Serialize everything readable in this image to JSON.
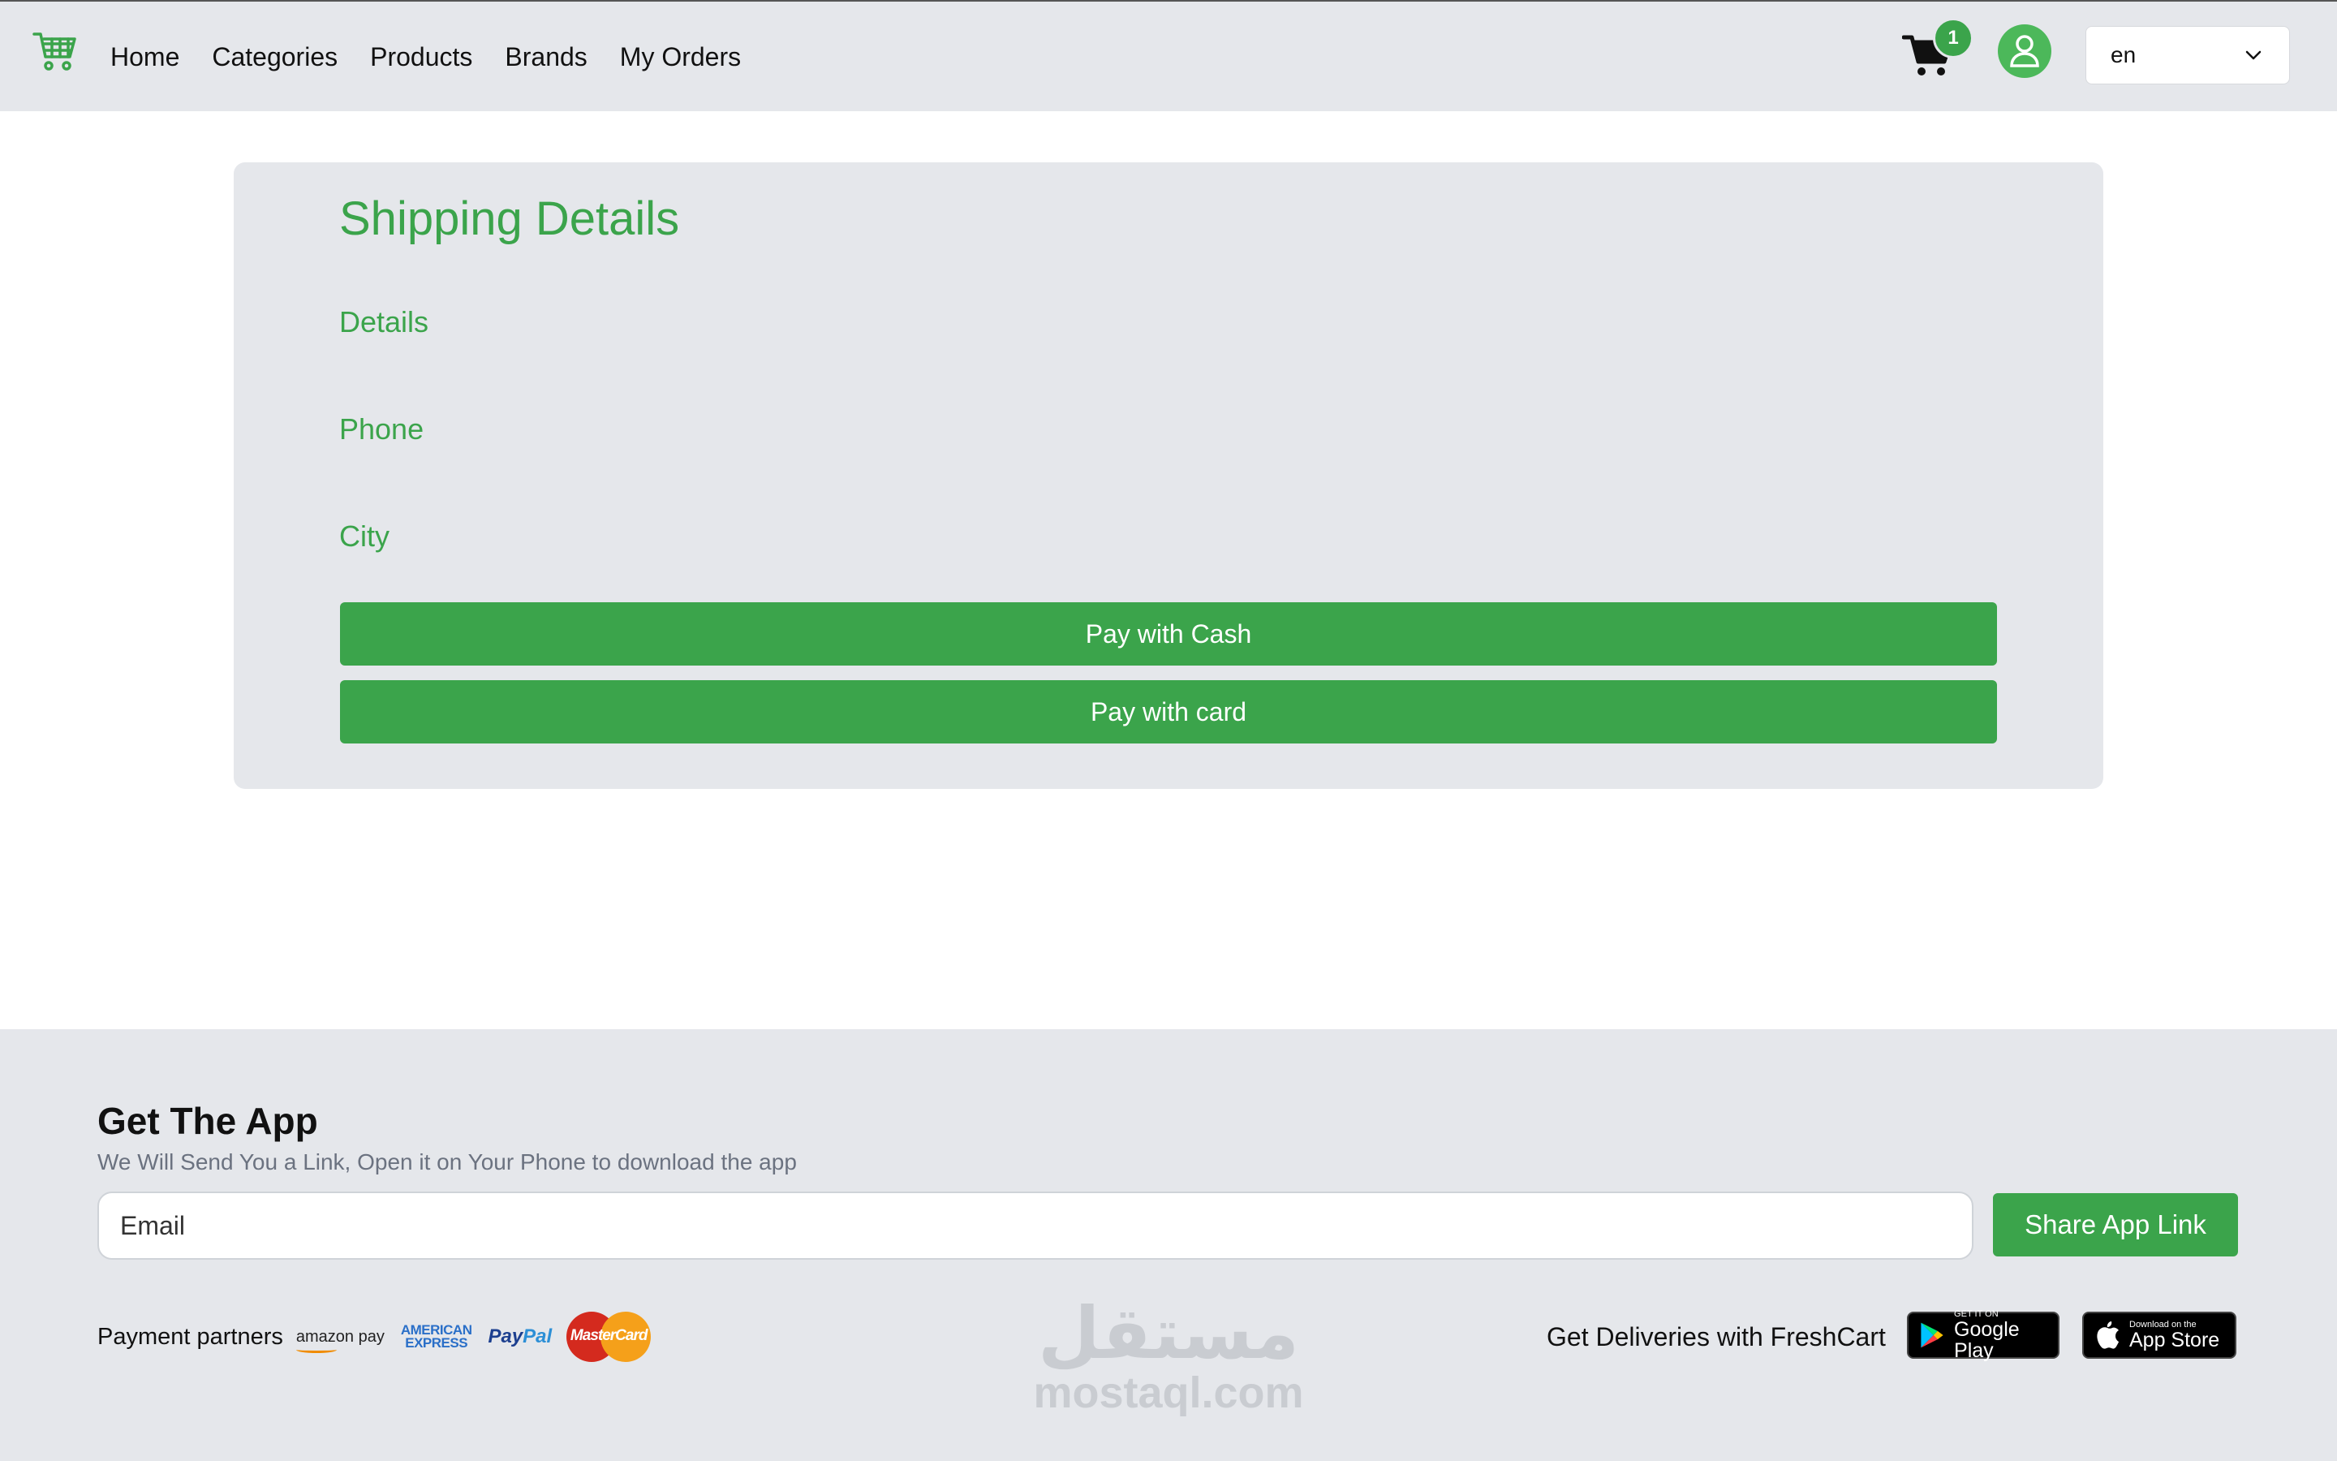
{
  "nav": {
    "links": [
      "Home",
      "Categories",
      "Products",
      "Brands",
      "My Orders"
    ],
    "cart_count": "1",
    "language": "en"
  },
  "shipping": {
    "title": "Shipping Details",
    "fields": [
      "Details",
      "Phone",
      "City"
    ],
    "pay_cash_label": "Pay with Cash",
    "pay_card_label": "Pay with card"
  },
  "footer": {
    "title": "Get The App",
    "subtitle": "We Will Send You a Link, Open it on Your Phone to download the app",
    "email_placeholder": "Email",
    "share_label": "Share App Link",
    "partners_label": "Payment partners",
    "partner_logos": {
      "amazon": "amazon pay",
      "amex_line1": "AMERICAN",
      "amex_line2": "EXPRESS",
      "paypal_pay": "Pay",
      "paypal_pal": "Pal",
      "mastercard": "MasterCard"
    },
    "watermark_ar": "مستقل",
    "watermark_en": "mostaql.com",
    "deliveries_label": "Get Deliveries with FreshCart",
    "google_play_small": "GET IT ON",
    "google_play_big": "Google Play",
    "app_store_small": "Download on the",
    "app_store_big": "App Store"
  },
  "colors": {
    "accent": "#3ba44b",
    "surface": "#e5e7eb"
  }
}
